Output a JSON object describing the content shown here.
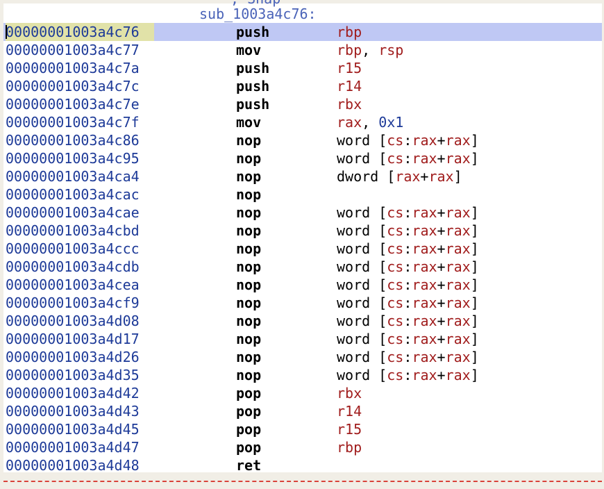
{
  "listing": {
    "clipped_comment": "; Snap",
    "label": "sub_1003a4c76:",
    "selected_index": 0,
    "colors": {
      "address": "#1d3a98",
      "register": "#a01c1c",
      "immediate": "#1d3a98",
      "label": "#4a63b8",
      "selection": "#bfc8f4",
      "address_highlight": "#e1e2a8",
      "separator": "#d9433a"
    },
    "rows": [
      {
        "address": "00000001003a4c76",
        "mnemonic": "push",
        "operands": [
          {
            "t": "reg",
            "v": "rbp"
          }
        ]
      },
      {
        "address": "00000001003a4c77",
        "mnemonic": "mov",
        "operands": [
          {
            "t": "reg",
            "v": "rbp"
          },
          {
            "t": "punct",
            "v": ", "
          },
          {
            "t": "reg",
            "v": "rsp"
          }
        ]
      },
      {
        "address": "00000001003a4c7a",
        "mnemonic": "push",
        "operands": [
          {
            "t": "reg",
            "v": "r15"
          }
        ]
      },
      {
        "address": "00000001003a4c7c",
        "mnemonic": "push",
        "operands": [
          {
            "t": "reg",
            "v": "r14"
          }
        ]
      },
      {
        "address": "00000001003a4c7e",
        "mnemonic": "push",
        "operands": [
          {
            "t": "reg",
            "v": "rbx"
          }
        ]
      },
      {
        "address": "00000001003a4c7f",
        "mnemonic": "mov",
        "operands": [
          {
            "t": "reg",
            "v": "rax"
          },
          {
            "t": "punct",
            "v": ", "
          },
          {
            "t": "num",
            "v": "0x1"
          }
        ]
      },
      {
        "address": "00000001003a4c86",
        "mnemonic": "nop",
        "operands": [
          {
            "t": "kw",
            "v": "word "
          },
          {
            "t": "punct",
            "v": "["
          },
          {
            "t": "reg",
            "v": "cs"
          },
          {
            "t": "punct",
            "v": ":"
          },
          {
            "t": "reg",
            "v": "rax"
          },
          {
            "t": "punct",
            "v": "+"
          },
          {
            "t": "reg",
            "v": "rax"
          },
          {
            "t": "punct",
            "v": "]"
          }
        ]
      },
      {
        "address": "00000001003a4c95",
        "mnemonic": "nop",
        "operands": [
          {
            "t": "kw",
            "v": "word "
          },
          {
            "t": "punct",
            "v": "["
          },
          {
            "t": "reg",
            "v": "cs"
          },
          {
            "t": "punct",
            "v": ":"
          },
          {
            "t": "reg",
            "v": "rax"
          },
          {
            "t": "punct",
            "v": "+"
          },
          {
            "t": "reg",
            "v": "rax"
          },
          {
            "t": "punct",
            "v": "]"
          }
        ]
      },
      {
        "address": "00000001003a4ca4",
        "mnemonic": "nop",
        "operands": [
          {
            "t": "kw",
            "v": "dword "
          },
          {
            "t": "punct",
            "v": "["
          },
          {
            "t": "reg",
            "v": "rax"
          },
          {
            "t": "punct",
            "v": "+"
          },
          {
            "t": "reg",
            "v": "rax"
          },
          {
            "t": "punct",
            "v": "]"
          }
        ]
      },
      {
        "address": "00000001003a4cac",
        "mnemonic": "nop",
        "operands": []
      },
      {
        "address": "00000001003a4cae",
        "mnemonic": "nop",
        "operands": [
          {
            "t": "kw",
            "v": "word "
          },
          {
            "t": "punct",
            "v": "["
          },
          {
            "t": "reg",
            "v": "cs"
          },
          {
            "t": "punct",
            "v": ":"
          },
          {
            "t": "reg",
            "v": "rax"
          },
          {
            "t": "punct",
            "v": "+"
          },
          {
            "t": "reg",
            "v": "rax"
          },
          {
            "t": "punct",
            "v": "]"
          }
        ]
      },
      {
        "address": "00000001003a4cbd",
        "mnemonic": "nop",
        "operands": [
          {
            "t": "kw",
            "v": "word "
          },
          {
            "t": "punct",
            "v": "["
          },
          {
            "t": "reg",
            "v": "cs"
          },
          {
            "t": "punct",
            "v": ":"
          },
          {
            "t": "reg",
            "v": "rax"
          },
          {
            "t": "punct",
            "v": "+"
          },
          {
            "t": "reg",
            "v": "rax"
          },
          {
            "t": "punct",
            "v": "]"
          }
        ]
      },
      {
        "address": "00000001003a4ccc",
        "mnemonic": "nop",
        "operands": [
          {
            "t": "kw",
            "v": "word "
          },
          {
            "t": "punct",
            "v": "["
          },
          {
            "t": "reg",
            "v": "cs"
          },
          {
            "t": "punct",
            "v": ":"
          },
          {
            "t": "reg",
            "v": "rax"
          },
          {
            "t": "punct",
            "v": "+"
          },
          {
            "t": "reg",
            "v": "rax"
          },
          {
            "t": "punct",
            "v": "]"
          }
        ]
      },
      {
        "address": "00000001003a4cdb",
        "mnemonic": "nop",
        "operands": [
          {
            "t": "kw",
            "v": "word "
          },
          {
            "t": "punct",
            "v": "["
          },
          {
            "t": "reg",
            "v": "cs"
          },
          {
            "t": "punct",
            "v": ":"
          },
          {
            "t": "reg",
            "v": "rax"
          },
          {
            "t": "punct",
            "v": "+"
          },
          {
            "t": "reg",
            "v": "rax"
          },
          {
            "t": "punct",
            "v": "]"
          }
        ]
      },
      {
        "address": "00000001003a4cea",
        "mnemonic": "nop",
        "operands": [
          {
            "t": "kw",
            "v": "word "
          },
          {
            "t": "punct",
            "v": "["
          },
          {
            "t": "reg",
            "v": "cs"
          },
          {
            "t": "punct",
            "v": ":"
          },
          {
            "t": "reg",
            "v": "rax"
          },
          {
            "t": "punct",
            "v": "+"
          },
          {
            "t": "reg",
            "v": "rax"
          },
          {
            "t": "punct",
            "v": "]"
          }
        ]
      },
      {
        "address": "00000001003a4cf9",
        "mnemonic": "nop",
        "operands": [
          {
            "t": "kw",
            "v": "word "
          },
          {
            "t": "punct",
            "v": "["
          },
          {
            "t": "reg",
            "v": "cs"
          },
          {
            "t": "punct",
            "v": ":"
          },
          {
            "t": "reg",
            "v": "rax"
          },
          {
            "t": "punct",
            "v": "+"
          },
          {
            "t": "reg",
            "v": "rax"
          },
          {
            "t": "punct",
            "v": "]"
          }
        ]
      },
      {
        "address": "00000001003a4d08",
        "mnemonic": "nop",
        "operands": [
          {
            "t": "kw",
            "v": "word "
          },
          {
            "t": "punct",
            "v": "["
          },
          {
            "t": "reg",
            "v": "cs"
          },
          {
            "t": "punct",
            "v": ":"
          },
          {
            "t": "reg",
            "v": "rax"
          },
          {
            "t": "punct",
            "v": "+"
          },
          {
            "t": "reg",
            "v": "rax"
          },
          {
            "t": "punct",
            "v": "]"
          }
        ]
      },
      {
        "address": "00000001003a4d17",
        "mnemonic": "nop",
        "operands": [
          {
            "t": "kw",
            "v": "word "
          },
          {
            "t": "punct",
            "v": "["
          },
          {
            "t": "reg",
            "v": "cs"
          },
          {
            "t": "punct",
            "v": ":"
          },
          {
            "t": "reg",
            "v": "rax"
          },
          {
            "t": "punct",
            "v": "+"
          },
          {
            "t": "reg",
            "v": "rax"
          },
          {
            "t": "punct",
            "v": "]"
          }
        ]
      },
      {
        "address": "00000001003a4d26",
        "mnemonic": "nop",
        "operands": [
          {
            "t": "kw",
            "v": "word "
          },
          {
            "t": "punct",
            "v": "["
          },
          {
            "t": "reg",
            "v": "cs"
          },
          {
            "t": "punct",
            "v": ":"
          },
          {
            "t": "reg",
            "v": "rax"
          },
          {
            "t": "punct",
            "v": "+"
          },
          {
            "t": "reg",
            "v": "rax"
          },
          {
            "t": "punct",
            "v": "]"
          }
        ]
      },
      {
        "address": "00000001003a4d35",
        "mnemonic": "nop",
        "operands": [
          {
            "t": "kw",
            "v": "word "
          },
          {
            "t": "punct",
            "v": "["
          },
          {
            "t": "reg",
            "v": "cs"
          },
          {
            "t": "punct",
            "v": ":"
          },
          {
            "t": "reg",
            "v": "rax"
          },
          {
            "t": "punct",
            "v": "+"
          },
          {
            "t": "reg",
            "v": "rax"
          },
          {
            "t": "punct",
            "v": "]"
          }
        ]
      },
      {
        "address": "00000001003a4d42",
        "mnemonic": "pop",
        "operands": [
          {
            "t": "reg",
            "v": "rbx"
          }
        ]
      },
      {
        "address": "00000001003a4d43",
        "mnemonic": "pop",
        "operands": [
          {
            "t": "reg",
            "v": "r14"
          }
        ]
      },
      {
        "address": "00000001003a4d45",
        "mnemonic": "pop",
        "operands": [
          {
            "t": "reg",
            "v": "r15"
          }
        ]
      },
      {
        "address": "00000001003a4d47",
        "mnemonic": "pop",
        "operands": [
          {
            "t": "reg",
            "v": "rbp"
          }
        ]
      },
      {
        "address": "00000001003a4d48",
        "mnemonic": "ret",
        "operands": []
      }
    ]
  }
}
